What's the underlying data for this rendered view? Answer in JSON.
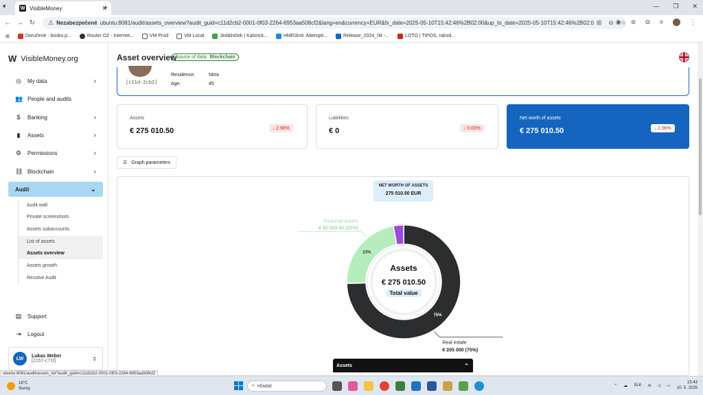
{
  "browser": {
    "tab_title": "VisibleMoney",
    "tab_favicon": "W",
    "insecure_label": "Nezabezpečené",
    "url": "ubuntu:8081/audit/assets_overview?audit_guid=c11d2cb2-0001-0f03-2264-6953aa508cf2&lang=en&currency=EUR&fx_date=2025-05-10T15:42:46%2B02:00&up_to_date=2025-05-10T15:42:46%2B02:00&blockchain=...",
    "bookmarks": [
      "Doručené - bosko.p...",
      "Router O2 - Internet...",
      "VM Prod",
      "VM Local",
      "Jedálniček | Kalorick...",
      "HMR3Init: Attempti...",
      "Release_2024_08 -...",
      "LOTO | TIPOS, národ..."
    ],
    "status_url": "ubuntu:8081/audit/assets_list?audit_guid=c11d2cb2-0001-0f03-2264-6953aa508cf2"
  },
  "sidebar": {
    "logo_text": "VisibleMoney.org",
    "items": [
      {
        "label": "My data",
        "icon": "person-icon"
      },
      {
        "label": "People and audits",
        "icon": "people-icon"
      },
      {
        "label": "Banking",
        "icon": "bank-icon"
      },
      {
        "label": "Assets",
        "icon": "bar-chart-icon"
      },
      {
        "label": "Permissions",
        "icon": "gear-icon"
      },
      {
        "label": "Blockchain",
        "icon": "blockchain-icon"
      },
      {
        "label": "Audit",
        "icon": ""
      }
    ],
    "audit_subitems": [
      "Audit wall",
      "Private screenshots",
      "Assets subaccounts",
      "List of assets",
      "Assets overview",
      "Assets growth",
      "Resolve Audit"
    ],
    "support_label": "Support",
    "logout_label": "Logout",
    "user": {
      "initials": "LW",
      "name": "Lukas Weber",
      "id": "[2157-c71f]"
    }
  },
  "header": {
    "title": "Asset overview",
    "source_prefix": "Source of data:",
    "source_value": "Blockchain"
  },
  "profile": {
    "code": "[c11d-2cb2]",
    "residence_label": "Residence:",
    "residence_value": "Nitra",
    "age_label": "Age:",
    "age_value": "45"
  },
  "kpis": {
    "assets": {
      "label": "Assets",
      "value": "€ 275 010.50",
      "change": "2.96%"
    },
    "liabilities": {
      "label": "Liabilities",
      "value": "€ 0",
      "change": "0.00%"
    },
    "net_worth": {
      "label": "Net worth of assets",
      "value": "€ 275 010.50",
      "change": "2.96%"
    }
  },
  "graph_params_label": "Graph parameters",
  "chart_data": {
    "type": "pie",
    "title": "NET WORTH OF ASSETS",
    "total_label": "275 010.50 EUR",
    "center_title": "Assets",
    "center_value": "€ 275 010.50",
    "center_sub": "Total value",
    "slices": [
      {
        "name": "Real estate",
        "value": 205000,
        "percent": 75,
        "value_label": "€ 205 000 (75%)",
        "pct_label": "75%",
        "color": "#2b2d2f"
      },
      {
        "name": "Financial assets",
        "value": 62010.5,
        "percent": 23,
        "value_label": "€ 62 010.50 (23%)",
        "pct_label": "23%",
        "color": "#b5edbd"
      },
      {
        "name": "",
        "value": 8000,
        "percent": 3,
        "value_label": "",
        "pct_label": "",
        "color": "#9c4bdb"
      }
    ]
  },
  "assets_panel_label": "Assets",
  "taskbar": {
    "weather_temp": "18°C",
    "weather_desc": "Sunny",
    "search_placeholder": "Hľadať",
    "lang": "SLK",
    "time": "15:43",
    "date": "10. 5. 2025"
  }
}
